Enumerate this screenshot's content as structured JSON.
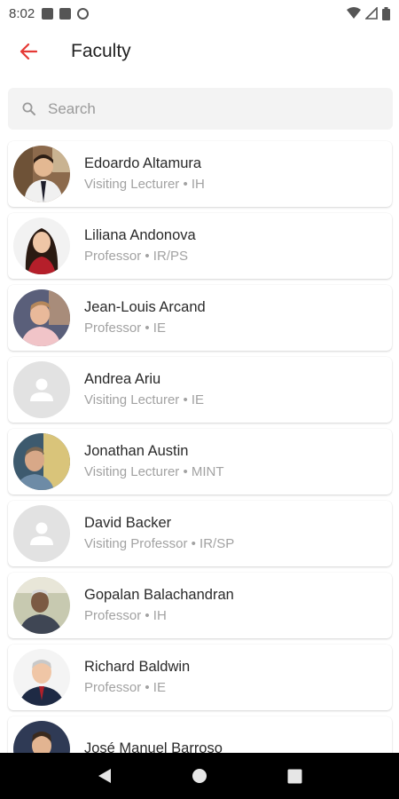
{
  "status_bar": {
    "time": "8:02"
  },
  "app_bar": {
    "title": "Faculty"
  },
  "search": {
    "placeholder": "Search"
  },
  "faculty": [
    {
      "name": "Edoardo Altamura",
      "role": "Visiting Lecturer • IH",
      "avatar": "photo"
    },
    {
      "name": "Liliana Andonova",
      "role": "Professor • IR/PS",
      "avatar": "photo"
    },
    {
      "name": "Jean-Louis Arcand",
      "role": "Professor • IE",
      "avatar": "photo"
    },
    {
      "name": "Andrea Ariu",
      "role": "Visiting Lecturer • IE",
      "avatar": "placeholder"
    },
    {
      "name": "Jonathan Austin",
      "role": "Visiting Lecturer • MINT",
      "avatar": "photo"
    },
    {
      "name": "David Backer",
      "role": "Visiting Professor • IR/SP",
      "avatar": "placeholder"
    },
    {
      "name": "Gopalan Balachandran",
      "role": "Professor • IH",
      "avatar": "photo"
    },
    {
      "name": "Richard Baldwin",
      "role": "Professor • IE",
      "avatar": "photo"
    },
    {
      "name": "José Manuel Barroso",
      "role": "",
      "avatar": "photo"
    }
  ],
  "colors": {
    "accent": "#e53935"
  }
}
